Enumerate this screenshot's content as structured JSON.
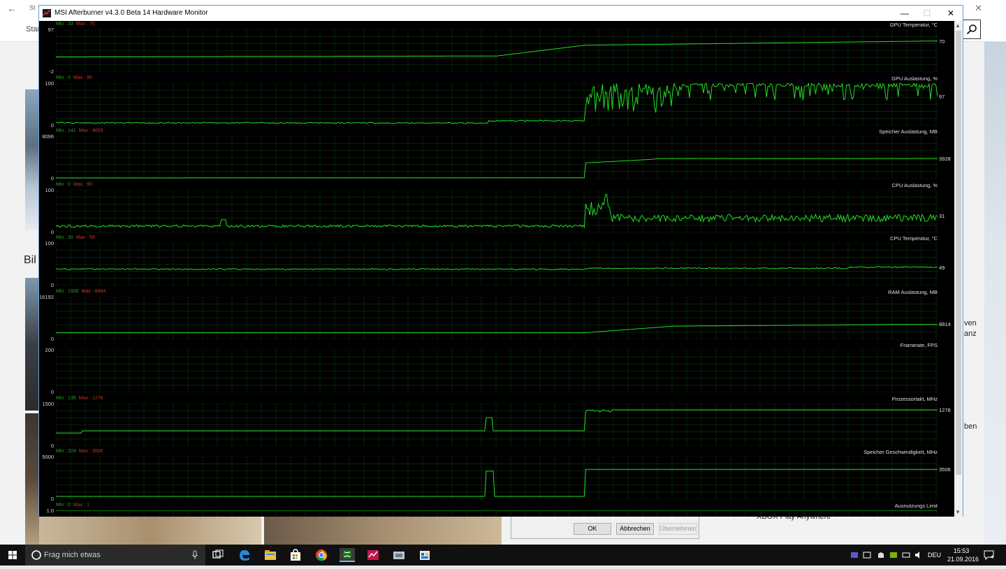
{
  "window": {
    "title": "MSI Afterburner v4.3.0 Beta 14 Hardware Monitor",
    "minimize": "—",
    "maximize": "☐",
    "close": "✕"
  },
  "panels": [
    {
      "title": "GPU Temperatur, °C",
      "min_label": "Min : 33",
      "max_label": "Max : 70",
      "y_max": "97",
      "y_min": "-2",
      "current": "70",
      "range": [
        -2,
        97
      ],
      "profile": "gputemp"
    },
    {
      "title": "GPU Auslastung, %",
      "min_label": "Min : 0",
      "max_label": "Max : 99",
      "y_max": "100",
      "y_min": "0",
      "current": "97",
      "range": [
        0,
        100
      ],
      "profile": "gpuload"
    },
    {
      "title": "Speicher Auslastung, MB",
      "min_label": "Min : 141",
      "max_label": "Max : 4059",
      "y_max": "8096",
      "y_min": "0",
      "current": "3928",
      "range": [
        0,
        8096
      ],
      "profile": "vram"
    },
    {
      "title": "CPU Auslastung, %",
      "min_label": "Min : 0",
      "max_label": "Max : 90",
      "y_max": "100",
      "y_min": "0",
      "current": "31",
      "range": [
        0,
        100
      ],
      "profile": "cpuload"
    },
    {
      "title": "CPU Temperatur, °C",
      "min_label": "Min : 30",
      "max_label": "Max : 59",
      "y_max": "100",
      "y_min": "0",
      "current": "49",
      "range": [
        0,
        100
      ],
      "profile": "cputemp"
    },
    {
      "title": "RAM Auslastung, MB",
      "min_label": "Min : 1930",
      "max_label": "Max : 8884",
      "y_max": "16192",
      "y_min": "0",
      "current": "8814",
      "range": [
        0,
        16192
      ],
      "profile": "ram"
    },
    {
      "title": "Framerate, FPS",
      "min_label": "",
      "max_label": "",
      "y_max": "200",
      "y_min": "0",
      "current": "",
      "range": [
        0,
        200
      ],
      "profile": "none"
    },
    {
      "title": "Prozessortakt, MHz",
      "min_label": "Min : 135",
      "max_label": "Max : 1278",
      "y_max": "1500",
      "y_min": "0",
      "current": "1278",
      "range": [
        0,
        1500
      ],
      "profile": "coreclock"
    },
    {
      "title": "Speicher Geschwindigkeit, MHz",
      "min_label": "Min : 324",
      "max_label": "Max : 3506",
      "y_max": "5000",
      "y_min": "0",
      "current": "3506",
      "range": [
        0,
        5000
      ],
      "profile": "memclock"
    },
    {
      "title": "Ausnutzungs Limit",
      "min_label": "Min : 0",
      "max_label": "Max : 1",
      "y_max": "1.0",
      "y_min": "",
      "current": "",
      "range": [
        0,
        1
      ],
      "profile": "limit"
    }
  ],
  "dialog": {
    "ok": "OK",
    "cancel": "Abbrechen",
    "apply": "Übernehmen"
  },
  "background": {
    "tab_text": "St",
    "nav_text": "Star",
    "heading_fragment": "Bil",
    "right_lines": [
      "ven",
      "anz",
      "ben"
    ],
    "xbox_text": "XBOX Play Anywhere"
  },
  "taskbar": {
    "search_placeholder": "Frag mich etwas",
    "language": "DEU",
    "time": "15:53",
    "date": "21.09.2016",
    "notifications": "4"
  },
  "colors": {
    "graph_line": "#22dd22",
    "grid": "#0c3a0c",
    "min_text": "#2f9d2f",
    "max_text": "#c0392b"
  }
}
